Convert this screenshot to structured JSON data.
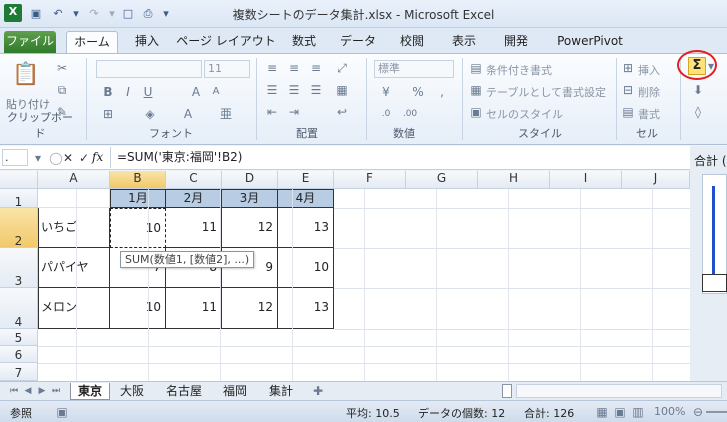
{
  "window": {
    "title": "複数シートのデータ集計.xlsx - Microsoft Excel"
  },
  "ribbon_tabs": [
    "ファイル",
    "ホーム",
    "挿入",
    "ページ レイアウト",
    "数式",
    "データ",
    "校閲",
    "表示",
    "開発",
    "PowerPivot"
  ],
  "ribbon": {
    "clipboard": {
      "paste": "貼り付け",
      "label": "クリップボード"
    },
    "font": {
      "size": "11",
      "label": "フォント"
    },
    "alignment": {
      "label": "配置"
    },
    "number": {
      "format": "標準",
      "label": "数値"
    },
    "style": {
      "conditional": "条件付き書式",
      "table": "テーブルとして書式設定",
      "cell": "セルのスタイル",
      "label": "スタイル"
    },
    "cells": {
      "insert": "挿入",
      "delete": "削除",
      "format": "書式",
      "label": "セル"
    },
    "autosum": "Σ"
  },
  "formula_bar": {
    "name_box": ".",
    "fx": "fx",
    "formula": "=SUM('東京:福岡'!B2)"
  },
  "sheet": {
    "columns": [
      "A",
      "B",
      "C",
      "D",
      "E",
      "F",
      "G",
      "H",
      "I",
      "J"
    ],
    "rows": [
      "1",
      "2",
      "3",
      "4",
      "5",
      "6",
      "7"
    ],
    "months": [
      "1月",
      "2月",
      "3月",
      "4月"
    ],
    "data": [
      {
        "name": "いちご",
        "values": [
          "10",
          "11",
          "12",
          "13"
        ]
      },
      {
        "name": "パパイヤ",
        "values": [
          "7",
          "8",
          "9",
          "10"
        ]
      },
      {
        "name": "メロン",
        "values": [
          "10",
          "11",
          "12",
          "13"
        ]
      }
    ],
    "tooltip": "SUM(数値1, [数値2], ...)"
  },
  "sheet_tabs": [
    "東京",
    "大阪",
    "名古屋",
    "福岡",
    "集計"
  ],
  "side_panel": {
    "title": "合計 ("
  },
  "status": {
    "mode": "参照",
    "average": "平均: 10.5",
    "count": "データの個数: 12",
    "sum": "合計: 126",
    "zoom": "100%"
  },
  "colors": {
    "file_tab": "#2f7a2a",
    "header_fill": "#b8cce4",
    "selected_header": "#f1c96a",
    "autosum_circle": "#e02020"
  }
}
